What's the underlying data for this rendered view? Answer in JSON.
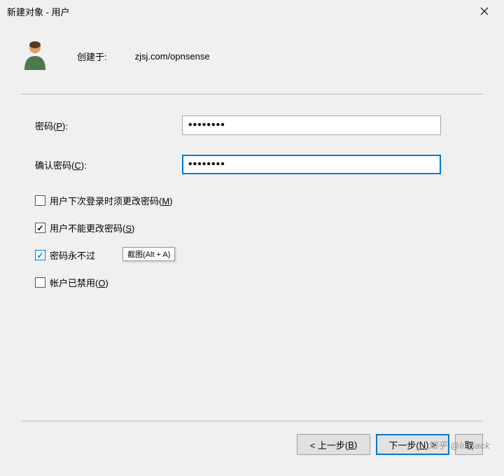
{
  "window": {
    "title": "新建对象 - 用户"
  },
  "header": {
    "create_label": "创建于:",
    "path": "zjsj.com/opnsense"
  },
  "form": {
    "password": {
      "label_pre": "密码(",
      "label_ul": "P",
      "label_post": "):",
      "value": "••••••••"
    },
    "confirm": {
      "label_pre": "确认密码(",
      "label_ul": "C",
      "label_post": "):",
      "value": "••••••••"
    }
  },
  "checkboxes": {
    "must_change": {
      "checked": false,
      "label_pre": "用户下次登录时须更改密码(",
      "label_ul": "M",
      "label_post": ")"
    },
    "cannot_change": {
      "checked": true,
      "label_pre": "用户不能更改密码(",
      "label_ul": "S",
      "label_post": ")"
    },
    "never_expires": {
      "checked": true,
      "label_visible": "密码永不过",
      "tooltip": "截图(Alt + A)"
    },
    "disabled": {
      "checked": false,
      "label_pre": "帐户已禁用(",
      "label_ul": "O",
      "label_post": ")"
    }
  },
  "buttons": {
    "back": {
      "pre": "< 上一步(",
      "ul": "B",
      "post": ")"
    },
    "next": {
      "pre": "下一步(",
      "ul": "N",
      "post": ") >"
    },
    "cancel_visible": "取"
  },
  "watermark": "知乎 @lnzjack"
}
